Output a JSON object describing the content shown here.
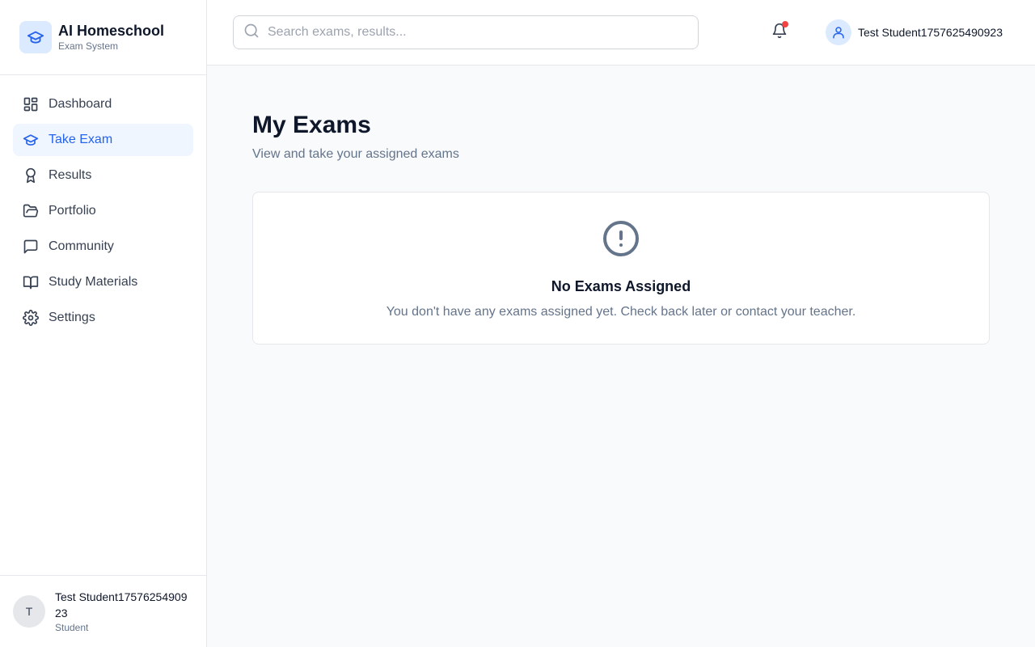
{
  "brand": {
    "title": "AI Homeschool",
    "subtitle": "Exam System"
  },
  "nav": {
    "items": [
      {
        "label": "Dashboard",
        "icon": "dashboard-icon",
        "active": false
      },
      {
        "label": "Take Exam",
        "icon": "graduation-cap-icon",
        "active": true
      },
      {
        "label": "Results",
        "icon": "award-icon",
        "active": false
      },
      {
        "label": "Portfolio",
        "icon": "folder-open-icon",
        "active": false
      },
      {
        "label": "Community",
        "icon": "message-square-icon",
        "active": false
      },
      {
        "label": "Study Materials",
        "icon": "book-open-icon",
        "active": false
      },
      {
        "label": "Settings",
        "icon": "gear-icon",
        "active": false
      }
    ]
  },
  "sidebar_user": {
    "initial": "T",
    "name": "Test Student1757625490923",
    "role": "Student"
  },
  "search": {
    "placeholder": "Search exams, results...",
    "value": ""
  },
  "header": {
    "user_name": "Test Student1757625490923",
    "has_notification": true
  },
  "main": {
    "title": "My Exams",
    "subtitle": "View and take your assigned exams",
    "empty_state": {
      "title": "No Exams Assigned",
      "message": "You don't have any exams assigned yet. Check back later or contact your teacher."
    }
  },
  "colors": {
    "accent": "#2563eb",
    "active_bg": "#eff6ff",
    "notification": "#ef4444"
  }
}
